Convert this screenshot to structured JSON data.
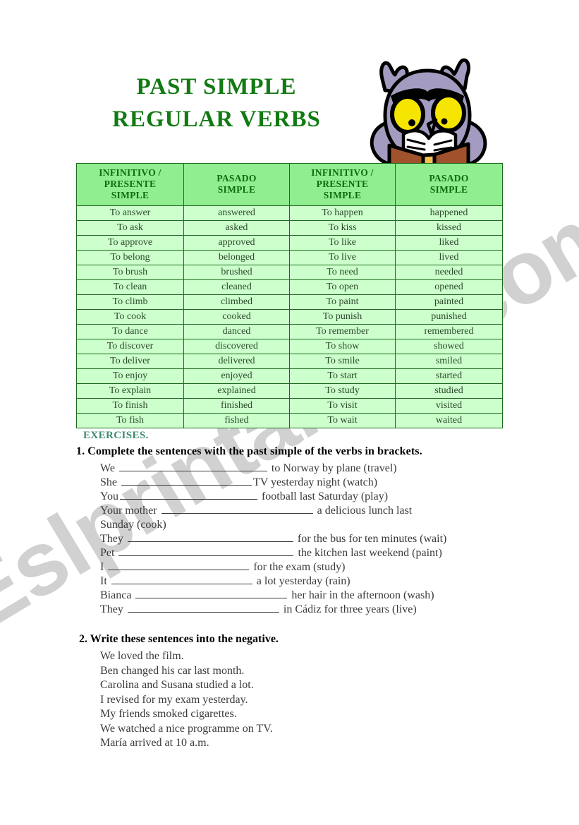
{
  "title": {
    "line1": "PAST SIMPLE",
    "line2": "REGULAR VERBS"
  },
  "colors": {
    "title_green": "#127a12",
    "header_cell_bg": "#90ee90",
    "body_cell_bg": "#ccffcc",
    "table_border": "#1d6b1d",
    "exercises_heading": "#3d8b6d",
    "owl_body": "#a49cc0",
    "owl_eye": "#f6e500",
    "owl_feet": "#ff9933",
    "owl_book": "#a0522d",
    "owl_book_spine": "#f2c14e",
    "watermark": "#c9c9c9"
  },
  "illustration": {
    "name": "owl-reading-book"
  },
  "watermark": {
    "text": "Eslprintables.com"
  },
  "table": {
    "headers": [
      "INFINITIVO / PRESENTE SIMPLE",
      "PASADO SIMPLE",
      "INFINITIVO / PRESENTE SIMPLE",
      "PASADO SIMPLE"
    ],
    "headers_lines": [
      [
        "INFINITIVO /",
        "PRESENTE",
        "SIMPLE"
      ],
      [
        "PASADO",
        "SIMPLE"
      ],
      [
        "INFINITIVO /",
        "PRESENTE",
        "SIMPLE"
      ],
      [
        "PASADO",
        "SIMPLE"
      ]
    ],
    "rows": [
      [
        "To answer",
        "answered",
        "To happen",
        "happened"
      ],
      [
        "To ask",
        "asked",
        "To kiss",
        "kissed"
      ],
      [
        "To approve",
        "approved",
        "To like",
        "liked"
      ],
      [
        "To belong",
        "belonged",
        "To live",
        "lived"
      ],
      [
        "To brush",
        "brushed",
        "To need",
        "needed"
      ],
      [
        "To clean",
        "cleaned",
        "To open",
        "opened"
      ],
      [
        "To climb",
        "climbed",
        "To paint",
        "painted"
      ],
      [
        "To cook",
        "cooked",
        "To punish",
        "punished"
      ],
      [
        "To dance",
        "danced",
        "To remember",
        "remembered"
      ],
      [
        "To discover",
        "discovered",
        "To show",
        "showed"
      ],
      [
        "To deliver",
        "delivered",
        "To smile",
        "smiled"
      ],
      [
        "To enjoy",
        "enjoyed",
        "To start",
        "started"
      ],
      [
        "To explain",
        "explained",
        "To study",
        "studied"
      ],
      [
        "To finish",
        "finished",
        "To visit",
        "visited"
      ],
      [
        "To fish",
        "fished",
        "To wait",
        "waited"
      ]
    ]
  },
  "exercises": {
    "heading": "EXERCISES.",
    "ex1": {
      "prompt": "1. Complete the sentences with the past simple of the verbs in brackets.",
      "items": [
        {
          "before": "We ",
          "blank_width": 210,
          "after": " to Norway by plane (travel)"
        },
        {
          "before": "She ",
          "blank_width": 185,
          "after": "TV yesterday night (watch)"
        },
        {
          "before": "You",
          "blank_width": 195,
          "after": " football last Saturday (play)"
        },
        {
          "before": "Your  mother ",
          "blank_width": 215,
          "after": " a delicious lunch last"
        },
        {
          "before": "Sunday (cook)",
          "blank_width": 0,
          "after": ""
        },
        {
          "before": "They ",
          "blank_width": 235,
          "after": " for the bus for ten minutes (wait)"
        },
        {
          "before": "Pet ",
          "blank_width": 248,
          "after": " the kitchen last weekend (paint)"
        },
        {
          "before": "I ",
          "blank_width": 200,
          "after": " for the exam (study)"
        },
        {
          "before": "It ",
          "blank_width": 200,
          "after": " a lot yesterday (rain)"
        },
        {
          "before": "Bianca ",
          "blank_width": 215,
          "after": " her hair in the afternoon (wash)"
        },
        {
          "before": "They ",
          "blank_width": 215,
          "after": " in Cádiz  for three years (live)"
        }
      ]
    },
    "ex2": {
      "prompt": "2. Write these sentences into the negative.",
      "items": [
        "We loved the film.",
        "Ben changed his car last month.",
        "Carolina and Susana studied a lot.",
        "I revised for my exam yesterday.",
        "My friends smoked cigarettes.",
        "We watched a nice programme on TV.",
        "María arrived at 10 a.m."
      ]
    }
  }
}
